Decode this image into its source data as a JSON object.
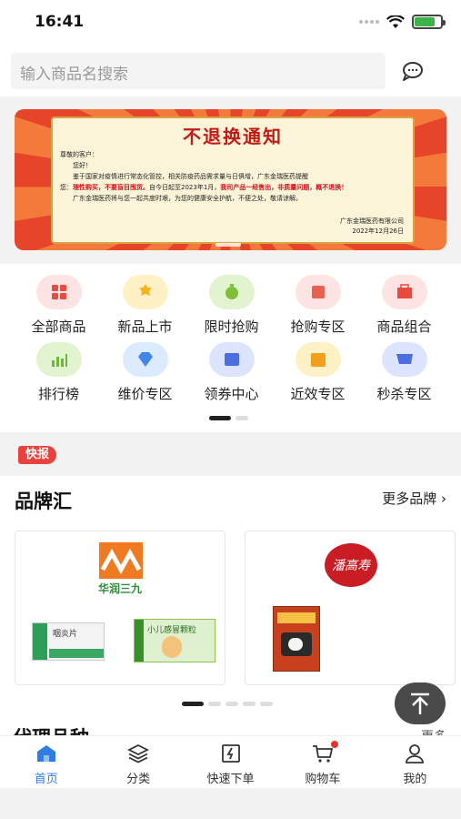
{
  "status_bar": {
    "time": "16:41"
  },
  "search": {
    "placeholder": "输入商品名搜索"
  },
  "banner": {
    "title": "不退换通知",
    "greeting": "尊敬的客户：",
    "hello": "您好！",
    "line1": "鉴于国家对疫情进行常态化管控，相关防疫药品需求量与日俱增，广东金瑞医药提醒",
    "line2_prefix": "您：",
    "line2_red": "理性购买，不要盲目囤货。",
    "line2_mid": "自今日起至2023年1月，",
    "line2_red2": "我司产品一经售出，非质量问题，概不退换！",
    "line3": "广东金瑞医药将与您一起共度时艰，为您的健康安全护航，不便之处，敬请谅解。",
    "company": "广东金瑞医药有限公司",
    "date": "2022年12月26日"
  },
  "categories": [
    {
      "label": "全部商品",
      "icon": "grid-icon",
      "color": "#fde3e1",
      "fg": "#e84a3f"
    },
    {
      "label": "新品上市",
      "icon": "new-badge-icon",
      "color": "#fff1c6",
      "fg": "#f5b21a"
    },
    {
      "label": "限时抢购",
      "icon": "timer-icon",
      "color": "#e2f3cf",
      "fg": "#7fbf3a"
    },
    {
      "label": "抢购专区",
      "icon": "rush-icon",
      "color": "#fde3e1",
      "fg": "#e8604f"
    },
    {
      "label": "商品组合",
      "icon": "combo-icon",
      "color": "#fde3e1",
      "fg": "#e84a3f"
    },
    {
      "label": "排行榜",
      "icon": "ranking-icon",
      "color": "#e2f3cf",
      "fg": "#6fb83a"
    },
    {
      "label": "维价专区",
      "icon": "diamond-icon",
      "color": "#dceaff",
      "fg": "#3f86e8"
    },
    {
      "label": "领券中心",
      "icon": "coupon-icon",
      "color": "#dde4ff",
      "fg": "#4d6ee0"
    },
    {
      "label": "近效专区",
      "icon": "calendar-icon",
      "color": "#fff1c6",
      "fg": "#f0a01a"
    },
    {
      "label": "秒杀专区",
      "icon": "flash-cart-icon",
      "color": "#dde4ff",
      "fg": "#4d6ee0"
    }
  ],
  "news": {
    "tag": "快报"
  },
  "brands": {
    "title": "品牌汇",
    "more": "更多品牌 ›",
    "items": [
      {
        "name": "华润三九",
        "logo": "hrsj-logo",
        "products": [
          "咽炎片",
          "小儿感冒颗粒"
        ]
      },
      {
        "name": "潘高寿",
        "logo": "pangaoshou-logo",
        "products": [
          ""
        ]
      }
    ]
  },
  "agent": {
    "title": "代理品种",
    "more": "更多"
  },
  "tabs": [
    {
      "label": "首页",
      "icon": "home-icon",
      "active": true
    },
    {
      "label": "分类",
      "icon": "layers-icon",
      "active": false
    },
    {
      "label": "快速下单",
      "icon": "quick-order-icon",
      "active": false
    },
    {
      "label": "购物车",
      "icon": "cart-icon",
      "active": false
    },
    {
      "label": "我的",
      "icon": "user-icon",
      "active": false
    }
  ],
  "colors": {
    "accent": "#2f7de1",
    "news_red": "#e9413b"
  }
}
